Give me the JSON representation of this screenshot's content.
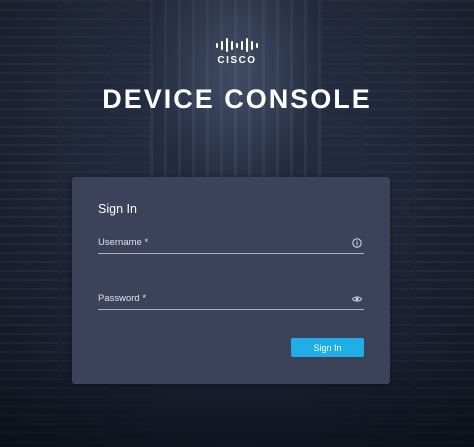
{
  "brand": {
    "logo_text": "CISCO"
  },
  "page": {
    "title": "DEVICE CONSOLE"
  },
  "login_card": {
    "heading": "Sign In",
    "username": {
      "label": "Username *",
      "value": "",
      "icon": "info-circle-icon"
    },
    "password": {
      "label": "Password *",
      "value": "",
      "icon": "eye-icon"
    },
    "submit_label": "Sign In"
  },
  "colors": {
    "accent": "#1faee6",
    "card_background": "#3b4259",
    "page_background": "#1d2437"
  }
}
